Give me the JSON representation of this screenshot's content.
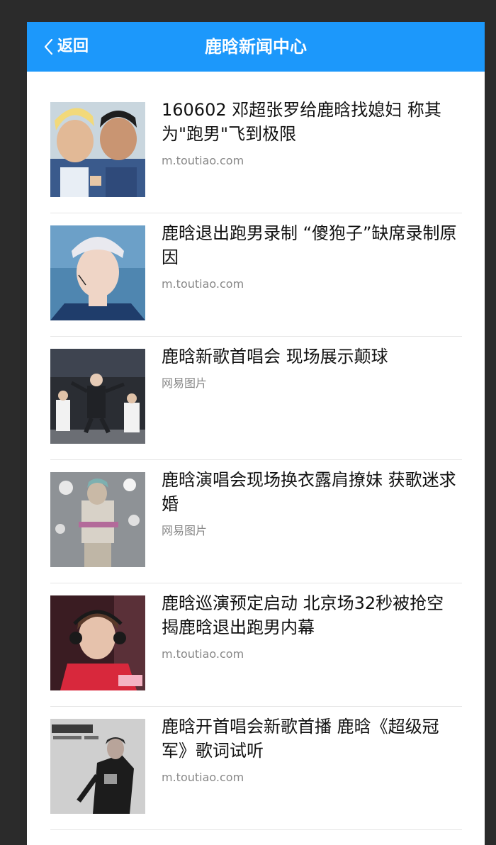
{
  "header": {
    "back_label": "返回",
    "title": "鹿晗新闻中心",
    "background": "#1c98fb"
  },
  "news": [
    {
      "title": "160602 邓超张罗给鹿晗找媳妇 称其为\"跑男\"飞到极限",
      "source": "m.toutiao.com"
    },
    {
      "title": "鹿晗退出跑男录制 “傻狍子”缺席录制原因",
      "source": "m.toutiao.com"
    },
    {
      "title": "鹿晗新歌首唱会 现场展示颠球",
      "source": "网易图片"
    },
    {
      "title": "鹿晗演唱会现场换衣露肩撩妹 获歌迷求婚",
      "source": "网易图片"
    },
    {
      "title": "鹿晗巡演预定启动 北京场32秒被抢空 揭鹿晗退出跑男内幕",
      "source": "m.toutiao.com"
    },
    {
      "title": "鹿晗开首唱会新歌首播 鹿晗《超级冠军》歌词试听",
      "source": "m.toutiao.com"
    }
  ]
}
